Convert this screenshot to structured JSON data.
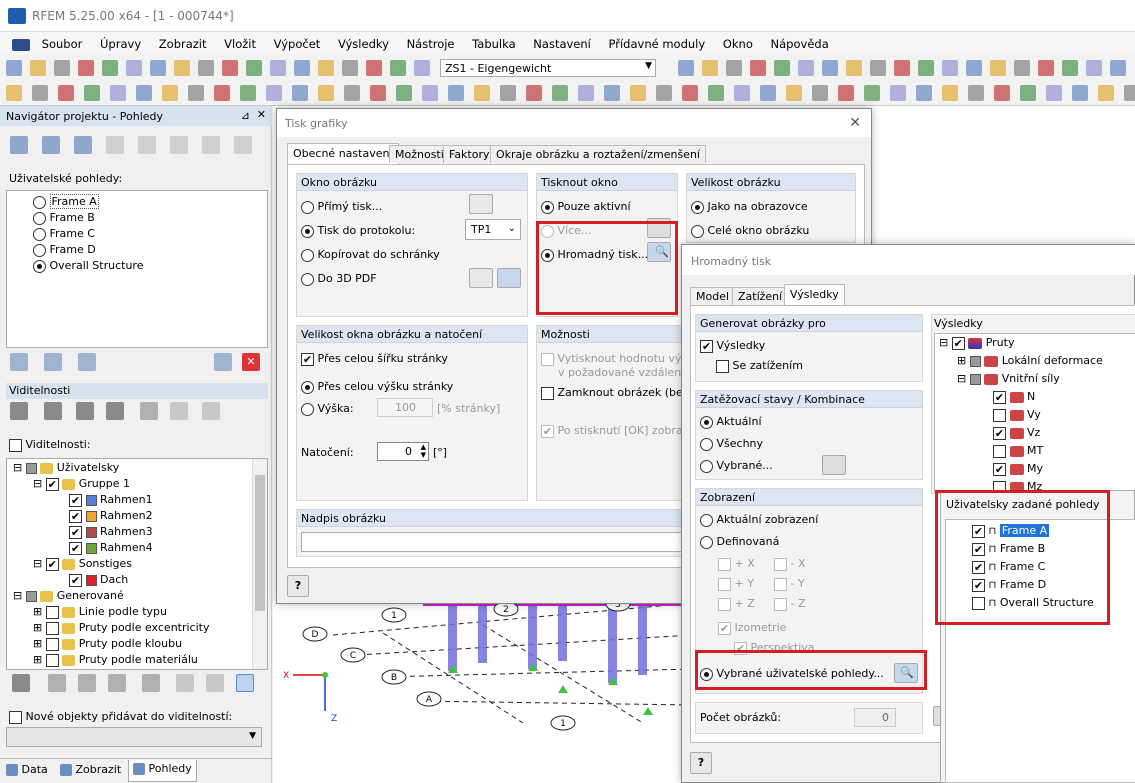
{
  "app": {
    "title": "RFEM 5.25.00 x64 - [1 - 000744*]"
  },
  "menu": [
    "Soubor",
    "Úpravy",
    "Zobrazit",
    "Vložit",
    "Výpočet",
    "Výsledky",
    "Nástroje",
    "Tabulka",
    "Nastavení",
    "Přídavné moduly",
    "Okno",
    "Nápověda"
  ],
  "toolbar": {
    "loadcase": "ZS1 - Eigengewicht"
  },
  "navigator": {
    "title": "Navigátor projektu - Pohledy",
    "user_views_label": "Uživatelské pohledy:",
    "views": [
      "Frame A",
      "Frame B",
      "Frame C",
      "Frame D",
      "Overall Structure"
    ],
    "visibility_title": "Viditelnosti",
    "visibility_check": "Viditelnosti:",
    "tree": [
      {
        "label": "Uživatelsky"
      },
      {
        "label": "Gruppe 1"
      },
      {
        "label": "Rahmen1",
        "color": "#4f7fd6"
      },
      {
        "label": "Rahmen2",
        "color": "#f2a531"
      },
      {
        "label": "Rahmen3",
        "color": "#b04a4a"
      },
      {
        "label": "Rahmen4",
        "color": "#6ea63a"
      },
      {
        "label": "Sonstiges"
      },
      {
        "label": "Dach",
        "color": "#e02020"
      },
      {
        "label": "Generované"
      },
      {
        "label": "Linie podle typu"
      },
      {
        "label": "Pruty podle excentricity"
      },
      {
        "label": "Pruty podle kloubu"
      },
      {
        "label": "Pruty podle materiálu"
      }
    ],
    "new_objects": "Nové objekty přidávat do viditelností:",
    "bottom_tabs": [
      "Data",
      "Zobrazit",
      "Pohledy"
    ]
  },
  "print_dialog": {
    "title": "Tisk grafiky",
    "tabs": [
      "Obecné nastavení",
      "Možnosti",
      "Faktory",
      "Okraje obrázku a roztažení/zmenšení"
    ],
    "okno": {
      "title": "Okno obrázku",
      "direct": "Přímý tisk...",
      "protocol": "Tisk do protokolu:",
      "protocol_value": "TP1",
      "clipboard": "Kopírovat do schránky",
      "pdf": "Do 3D PDF"
    },
    "tisknout": {
      "title": "Tisknout okno",
      "active": "Pouze aktivní",
      "more": "Více...",
      "mass": "Hromadný tisk..."
    },
    "velikost": {
      "title": "Velikost obrázku",
      "screen": "Jako na obrazovce",
      "whole": "Celé okno obrázku"
    },
    "rotace": {
      "title": "Velikost okna obrázku a natočení",
      "width": "Přes celou šířku stránky",
      "height": "Přes celou výšku stránky",
      "vyska": "Výška:",
      "vyska_value": "100",
      "vyska_unit": "[% stránky]",
      "rotation": "Natočení:",
      "rotation_value": "0",
      "rotation_unit": "[°]"
    },
    "moznosti": {
      "title": "Možnosti",
      "print_value": "Vytisknout hodnotu výsledk",
      "print_value2": "v požadované vzdálenosti ",
      "lock": "Zamknout obrázek (bez akt",
      "after_ok": "Po stisknutí [OK] zobrazit p"
    },
    "caption": {
      "title": "Nadpis obrázku"
    }
  },
  "mass_dialog": {
    "title": "Hromadný tisk",
    "tabs": [
      "Model",
      "Zatížení",
      "Výsledky"
    ],
    "generate": {
      "title": "Generovat obrázky pro",
      "results": "Výsledky",
      "with_load": "Se zatížením"
    },
    "lc": {
      "title": "Zatěžovací stavy / Kombinace",
      "current": "Aktuální",
      "all": "Všechny",
      "selected": "Vybrané..."
    },
    "display": {
      "title": "Zobrazení",
      "current": "Aktuální zobrazení",
      "defined": "Definovaná",
      "dirs": [
        "+ X",
        "- X",
        "+ Y",
        "- Y",
        "+ Z",
        "- Z"
      ],
      "iso": "Izometrie",
      "persp": "Perspektiva",
      "user_views": "Vybrané uživatelské pohledy..."
    },
    "count_label": "Počet obrázků:",
    "count_value": "0",
    "results_title": "Výsledky",
    "results_tree": [
      "Pruty",
      "Lokální deformace",
      "Vnitřní síly",
      "N",
      "Vy",
      "Vz",
      "MT",
      "My",
      "Mz"
    ],
    "user_views_title": "Uživatelsky zadané pohledy",
    "user_views": [
      {
        "label": "Frame A",
        "checked": true
      },
      {
        "label": "Frame B",
        "checked": true
      },
      {
        "label": "Frame C",
        "checked": true
      },
      {
        "label": "Frame D",
        "checked": true
      },
      {
        "label": "Overall Structure",
        "checked": false
      }
    ]
  },
  "viewport": {
    "labels": [
      "D",
      "C",
      "B",
      "A",
      "1",
      "2",
      "3",
      "1"
    ],
    "axis_x": "X",
    "axis_z": "Z"
  }
}
